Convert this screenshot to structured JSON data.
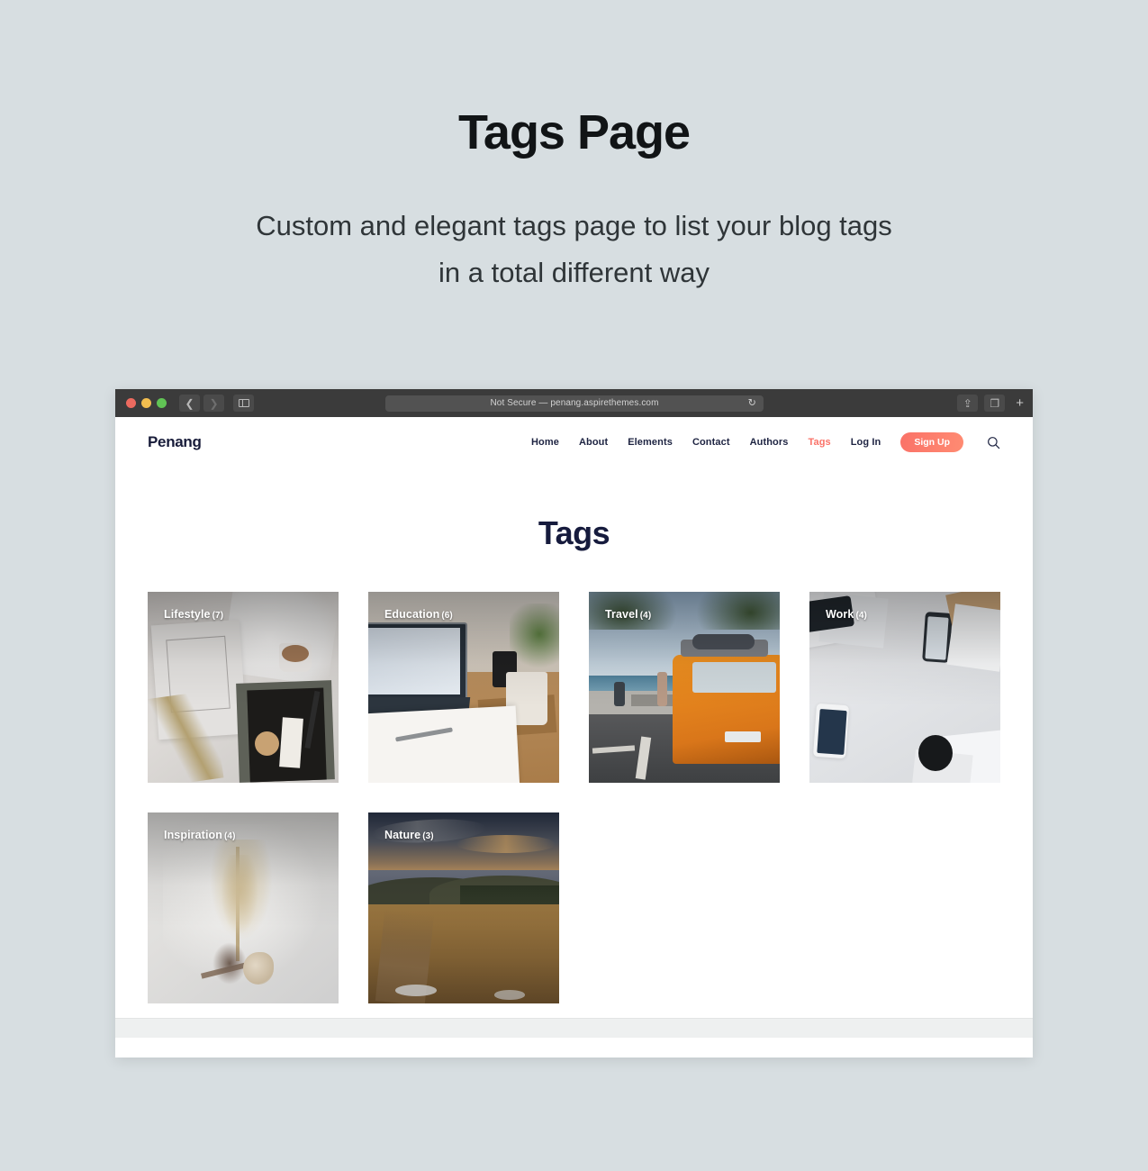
{
  "promo": {
    "title": "Tags Page",
    "subtitle_line1": "Custom and elegant tags page to list your blog tags",
    "subtitle_line2": "in a total different way"
  },
  "browser": {
    "url_text": "Not Secure — penang.aspirethemes.com",
    "reload_icon": "reload-icon",
    "back_icon": "back-chevron-icon",
    "forward_icon": "forward-chevron-icon",
    "sidebar_icon": "sidebar-toggle-icon",
    "share_icon": "share-icon",
    "tabs_icon": "tab-overview-icon",
    "new_tab_label": "+"
  },
  "site": {
    "logo": "Penang",
    "nav": [
      {
        "label": "Home",
        "active": false
      },
      {
        "label": "About",
        "active": false
      },
      {
        "label": "Elements",
        "active": false
      },
      {
        "label": "Contact",
        "active": false
      },
      {
        "label": "Authors",
        "active": false
      },
      {
        "label": "Tags",
        "active": true
      },
      {
        "label": "Log In",
        "active": false
      }
    ],
    "signup_label": "Sign Up",
    "search_icon": "search-icon",
    "page_heading": "Tags",
    "tags": [
      {
        "name": "Lifestyle",
        "count": "(7)"
      },
      {
        "name": "Education",
        "count": "(6)"
      },
      {
        "name": "Travel",
        "count": "(4)"
      },
      {
        "name": "Work",
        "count": "(4)"
      },
      {
        "name": "Inspiration",
        "count": "(4)"
      },
      {
        "name": "Nature",
        "count": "(3)"
      }
    ]
  },
  "colors": {
    "page_background": "#d7dee1",
    "accent": "#fa7268",
    "heading_navy": "#161b3d",
    "chrome": "#3b3b3b"
  }
}
